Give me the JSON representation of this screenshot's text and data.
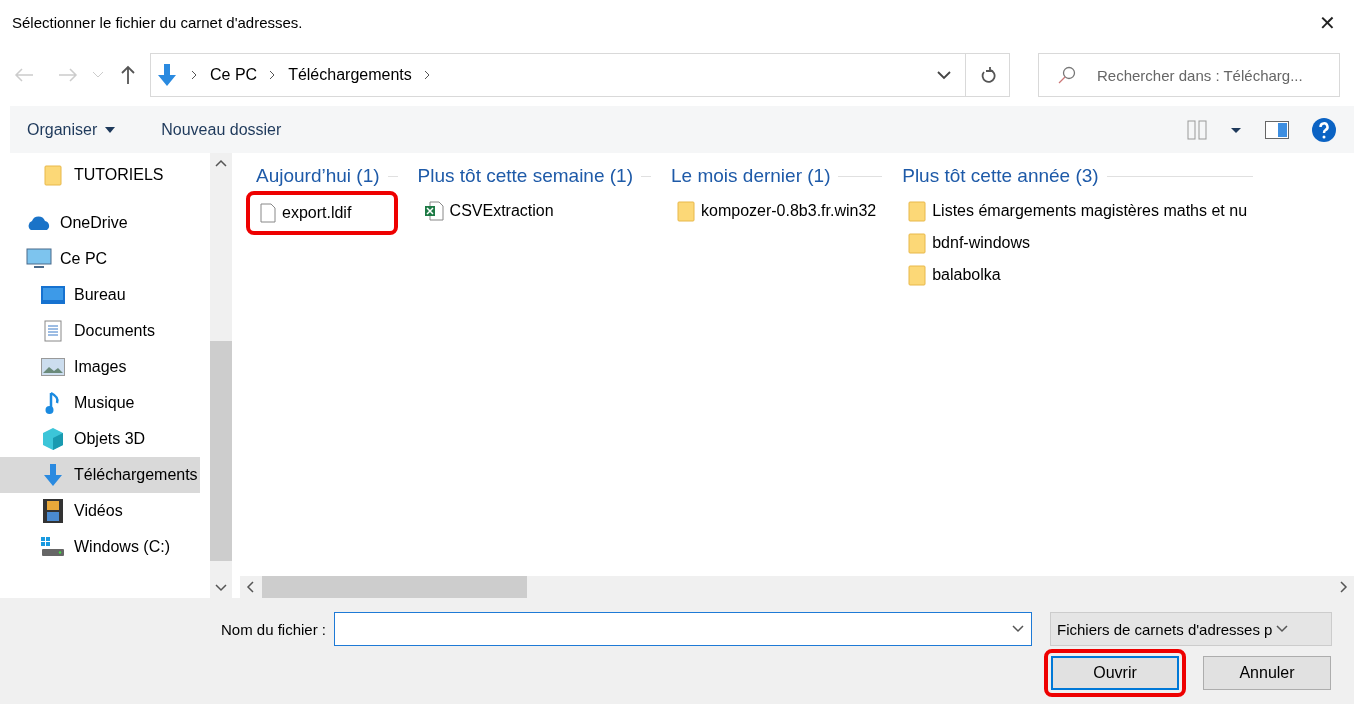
{
  "window": {
    "title": "Sélectionner le fichier du carnet d'adresses.",
    "close": "✕"
  },
  "address": {
    "segments": [
      "Ce PC",
      "Téléchargements"
    ]
  },
  "search": {
    "placeholder": "Rechercher dans : Télécharg..."
  },
  "toolbar": {
    "organize": "Organiser",
    "new_folder": "Nouveau dossier"
  },
  "sidebar": {
    "items": [
      {
        "children": [
          {
            "label": "TUTORIELS",
            "kind": "folder",
            "selected": false
          }
        ]
      },
      {
        "label": "OneDrive",
        "kind": "cloud",
        "selected": false
      },
      {
        "label": "Ce PC",
        "kind": "monitor",
        "selected": false,
        "children": [
          {
            "label": "Bureau",
            "kind": "desktop",
            "selected": false
          },
          {
            "label": "Documents",
            "kind": "document",
            "selected": false
          },
          {
            "label": "Images",
            "kind": "image",
            "selected": false
          },
          {
            "label": "Musique",
            "kind": "music",
            "selected": false
          },
          {
            "label": "Objets 3D",
            "kind": "cube",
            "selected": false
          },
          {
            "label": "Téléchargements",
            "kind": "download",
            "selected": true
          },
          {
            "label": "Vidéos",
            "kind": "video",
            "selected": false
          },
          {
            "label": "Windows (C:)",
            "kind": "drive",
            "selected": false
          }
        ]
      }
    ]
  },
  "groups": [
    {
      "header": "Aujourd’hui (1)",
      "files": [
        {
          "name": "export.ldif",
          "kind": "file",
          "highlighted": true
        }
      ]
    },
    {
      "header": "Plus tôt cette semaine (1)",
      "files": [
        {
          "name": "CSVExtraction",
          "kind": "excel",
          "highlighted": false
        }
      ]
    },
    {
      "header": "Le mois dernier (1)",
      "files": [
        {
          "name": "kompozer-0.8b3.fr.win32",
          "kind": "folder",
          "highlighted": false
        }
      ]
    },
    {
      "header": "Plus tôt cette année (3)",
      "files": [
        {
          "name": "Listes émargements magistères maths et nu",
          "kind": "folder",
          "highlighted": false
        },
        {
          "name": "bdnf-windows",
          "kind": "folder",
          "highlighted": false
        },
        {
          "name": "balabolka",
          "kind": "folder",
          "highlighted": false
        }
      ]
    }
  ],
  "filename": {
    "label": "Nom du fichier :"
  },
  "filetype": {
    "value": "Fichiers de carnets d'adresses p"
  },
  "buttons": [
    {
      "label": "Ouvrir",
      "default": true,
      "highlighted": true
    },
    {
      "label": "Annuler",
      "default": false,
      "highlighted": false
    }
  ]
}
